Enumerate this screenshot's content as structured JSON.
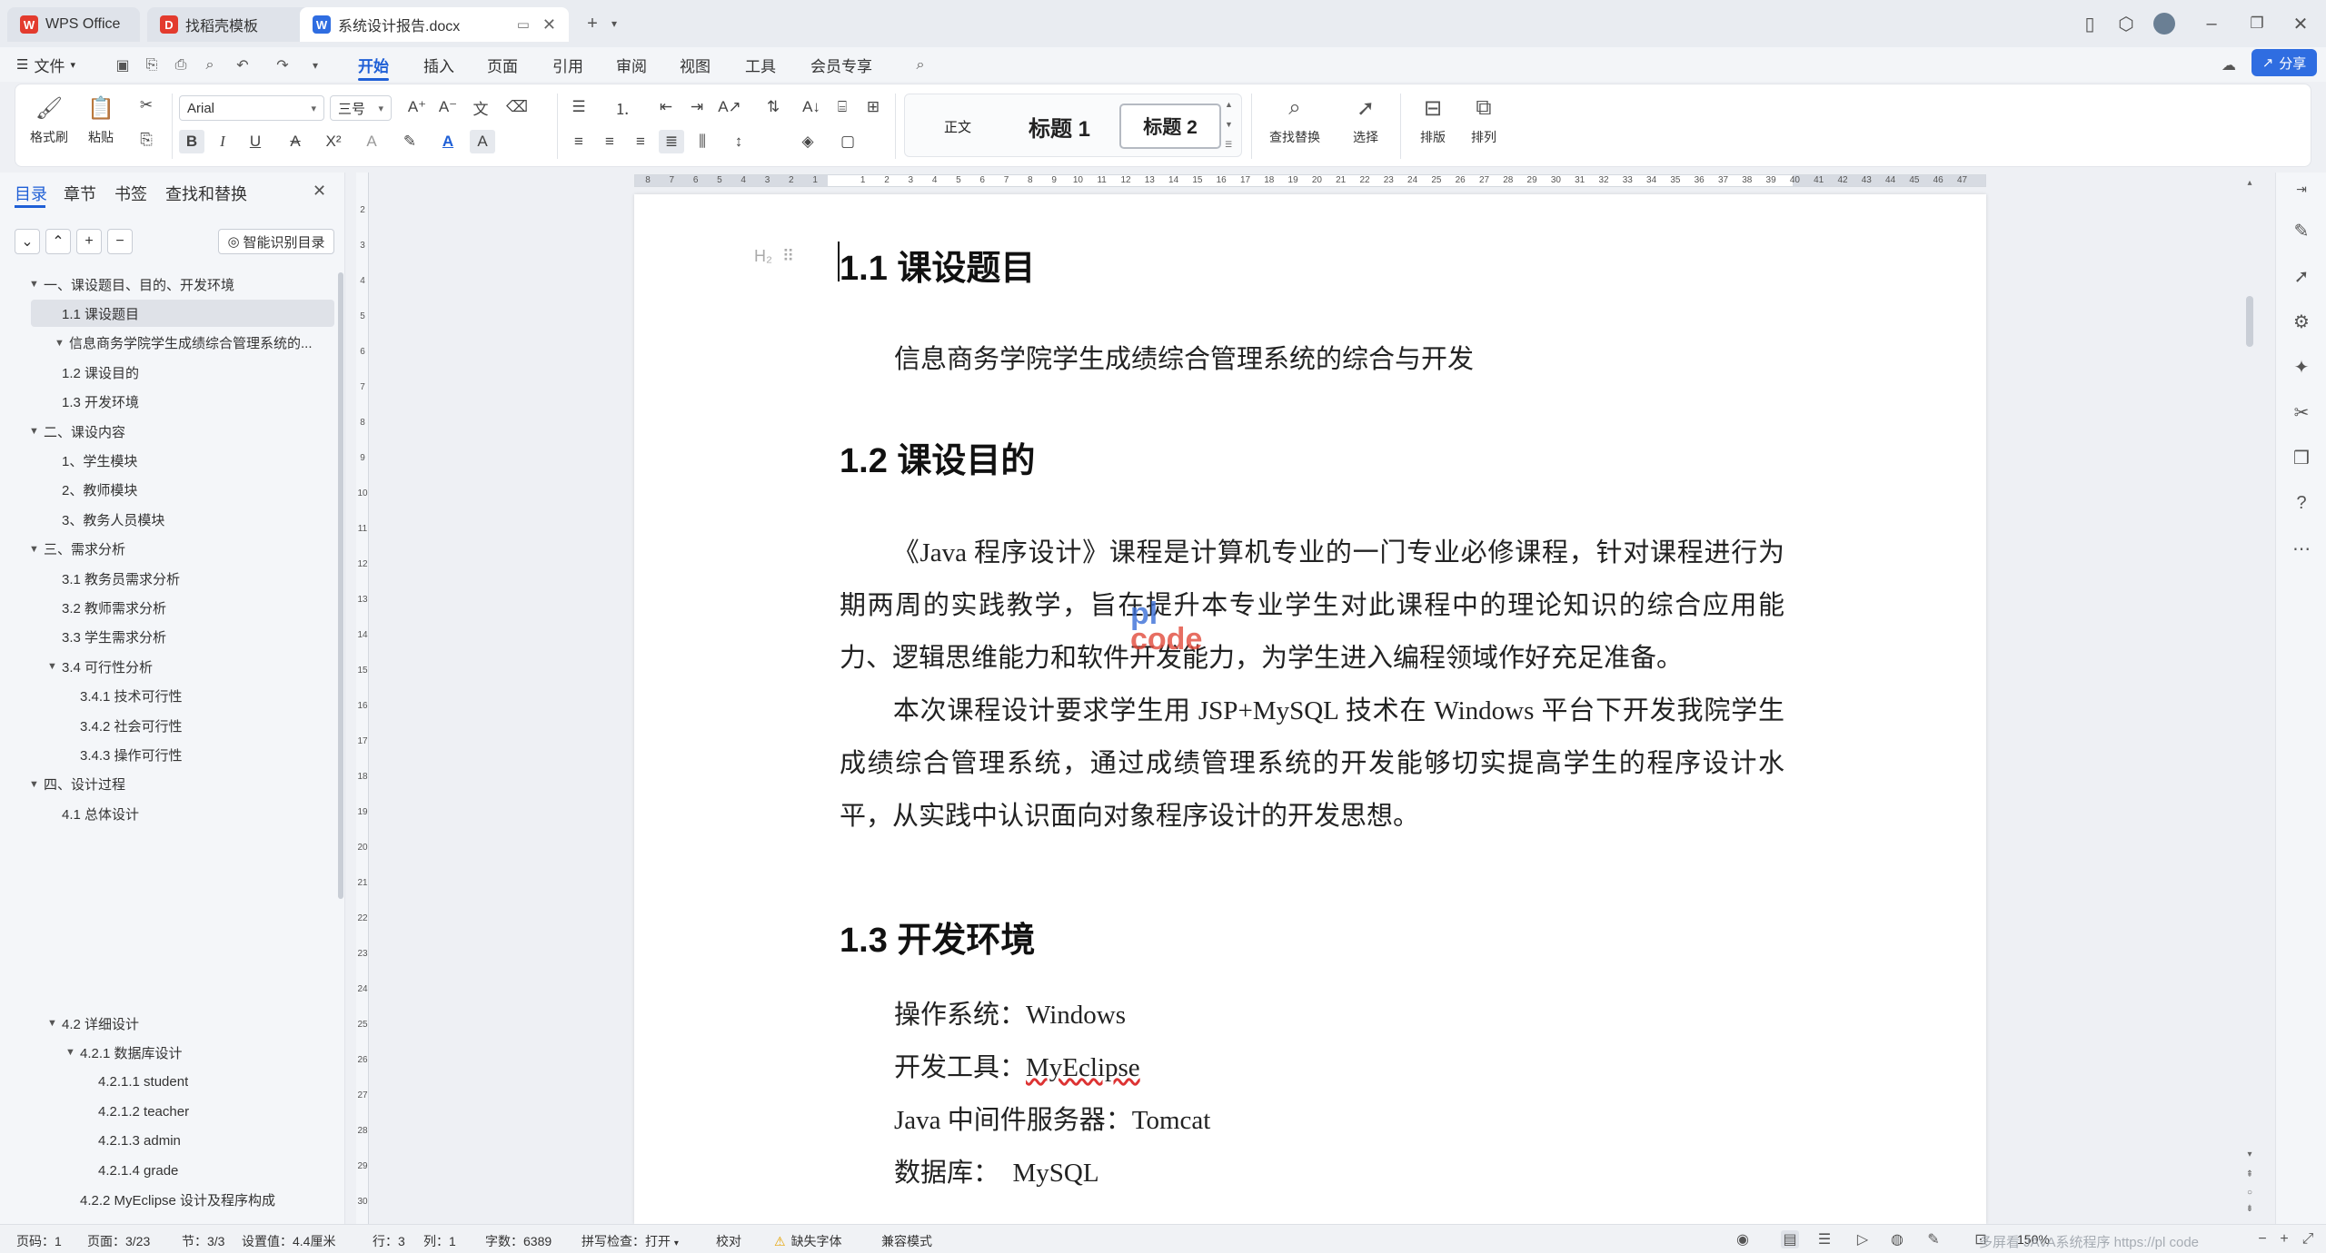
{
  "titlebar": {
    "tabs": [
      {
        "label": "WPS Office",
        "icon": "wps-logo-icon",
        "color": "#e33b2e"
      },
      {
        "label": "找稻壳模板",
        "icon": "docer-icon",
        "color": "#e33b2e"
      },
      {
        "label": "系统设计报告.docx",
        "icon": "word-doc-icon",
        "color": "#2f6de1"
      }
    ],
    "new_tab": "+"
  },
  "menubar": {
    "file": "文件",
    "tabs": [
      "开始",
      "插入",
      "页面",
      "引用",
      "审阅",
      "视图",
      "工具",
      "会员专享"
    ],
    "active_tab": "开始",
    "share": "分享"
  },
  "ribbon": {
    "format_painter": "格式刷",
    "paste": "粘贴",
    "font_name": "Arial",
    "font_size": "三号",
    "styles": [
      "正文",
      "标题 1",
      "标题 2"
    ],
    "find_replace": "查找替换",
    "select": "选择",
    "layout": "排版",
    "arrange": "排列"
  },
  "navpane": {
    "tabs": [
      "目录",
      "章节",
      "书签",
      "查找和替换"
    ],
    "active_tab": "目录",
    "smart_toc": "智能识别目录",
    "items": [
      {
        "label": "一、课设题目、目的、开发环境",
        "level": 0,
        "caret": "▼"
      },
      {
        "label": "1.1 课设题目",
        "level": 1,
        "caret": "",
        "selected": true
      },
      {
        "label": "信息商务学院学生成绩综合管理系统的...",
        "level": 0,
        "caret": "▼",
        "extra": true
      },
      {
        "label": "1.2 课设目的",
        "level": 1,
        "caret": ""
      },
      {
        "label": "1.3 开发环境",
        "level": 1,
        "caret": ""
      },
      {
        "label": "二、课设内容",
        "level": 0,
        "caret": "▼"
      },
      {
        "label": "1、学生模块",
        "level": 1,
        "caret": ""
      },
      {
        "label": "2、教师模块",
        "level": 1,
        "caret": ""
      },
      {
        "label": "3、教务人员模块",
        "level": 1,
        "caret": ""
      },
      {
        "label": "三、需求分析",
        "level": 0,
        "caret": "▼"
      },
      {
        "label": "3.1 教务员需求分析",
        "level": 1,
        "caret": ""
      },
      {
        "label": "3.2 教师需求分析",
        "level": 1,
        "caret": ""
      },
      {
        "label": "3.3 学生需求分析",
        "level": 1,
        "caret": ""
      },
      {
        "label": "3.4 可行性分析",
        "level": 1,
        "caret": "▼"
      },
      {
        "label": "3.4.1 技术可行性",
        "level": 2,
        "caret": ""
      },
      {
        "label": "3.4.2 社会可行性",
        "level": 2,
        "caret": ""
      },
      {
        "label": "3.4.3 操作可行性",
        "level": 2,
        "caret": ""
      },
      {
        "label": "四、设计过程",
        "level": 0,
        "caret": "▼"
      },
      {
        "label": "4.1 总体设计",
        "level": 1,
        "caret": ""
      }
    ],
    "items_lower": [
      {
        "label": "4.2 详细设计",
        "level": 1,
        "caret": "▼"
      },
      {
        "label": "4.2.1 数据库设计",
        "level": 2,
        "caret": "▼"
      },
      {
        "label": "4.2.1.1 student",
        "level": 3,
        "caret": ""
      },
      {
        "label": "4.2.1.2 teacher",
        "level": 3,
        "caret": ""
      },
      {
        "label": "4.2.1.3 admin",
        "level": 3,
        "caret": ""
      },
      {
        "label": "4.2.1.4 grade",
        "level": 3,
        "caret": ""
      },
      {
        "label": "4.2.2 MyEclipse 设计及程序构成",
        "level": 2,
        "caret": ""
      }
    ]
  },
  "document": {
    "style_marker": "H₂",
    "h1": "1.1 课设题目",
    "p1": "信息商务学院学生成绩综合管理系统的综合与开发",
    "h2": "1.2 课设目的",
    "p2": "《Java 程序设计》课程是计算机专业的一门专业必修课程，针对课程进行为期两周的实践教学，旨在提升本专业学生对此课程中的理论知识的综合应用能力、逻辑思维能力和软件开发能力，为学生进入编程领域作好充足准备。",
    "p3": "本次课程设计要求学生用 JSP+MySQL 技术在 Windows 平台下开发我院学生成绩综合管理系统，通过成绩管理系统的开发能够切实提高学生的程序设计水平，从实践中认识面向对象程序设计的开发思想。",
    "h3": "1.3 开发环境",
    "env": [
      {
        "label": "操作系统：",
        "value": "Windows"
      },
      {
        "label": "开发工具：",
        "value": "MyEclipse"
      },
      {
        "label": "Java 中间件服务器：",
        "value": "Tomcat"
      },
      {
        "label": "数据库：  ",
        "value": "MySQL"
      }
    ],
    "watermark_top": "pl",
    "watermark_bottom": "code"
  },
  "statusbar": {
    "page_code": "页码：1",
    "page": "页面：3/23",
    "section": "节：3/3",
    "setting": "设置值：4.4厘米",
    "row": "行：3",
    "col": "列：1",
    "words": "字数：6389",
    "spell": "拼写检查：打开",
    "proof": "校对",
    "missing_font": "缺失字体",
    "compat": "兼容模式",
    "zoom": "150%",
    "footer_text": "多屏看 JAVA系统程序 https://pl code"
  },
  "colors": {
    "accent": "#1f5fd6",
    "share": "#2f6de1",
    "wps_red": "#e33b2e",
    "watermark_blue": "#3a6fd8",
    "watermark_red": "#e24a3b"
  }
}
